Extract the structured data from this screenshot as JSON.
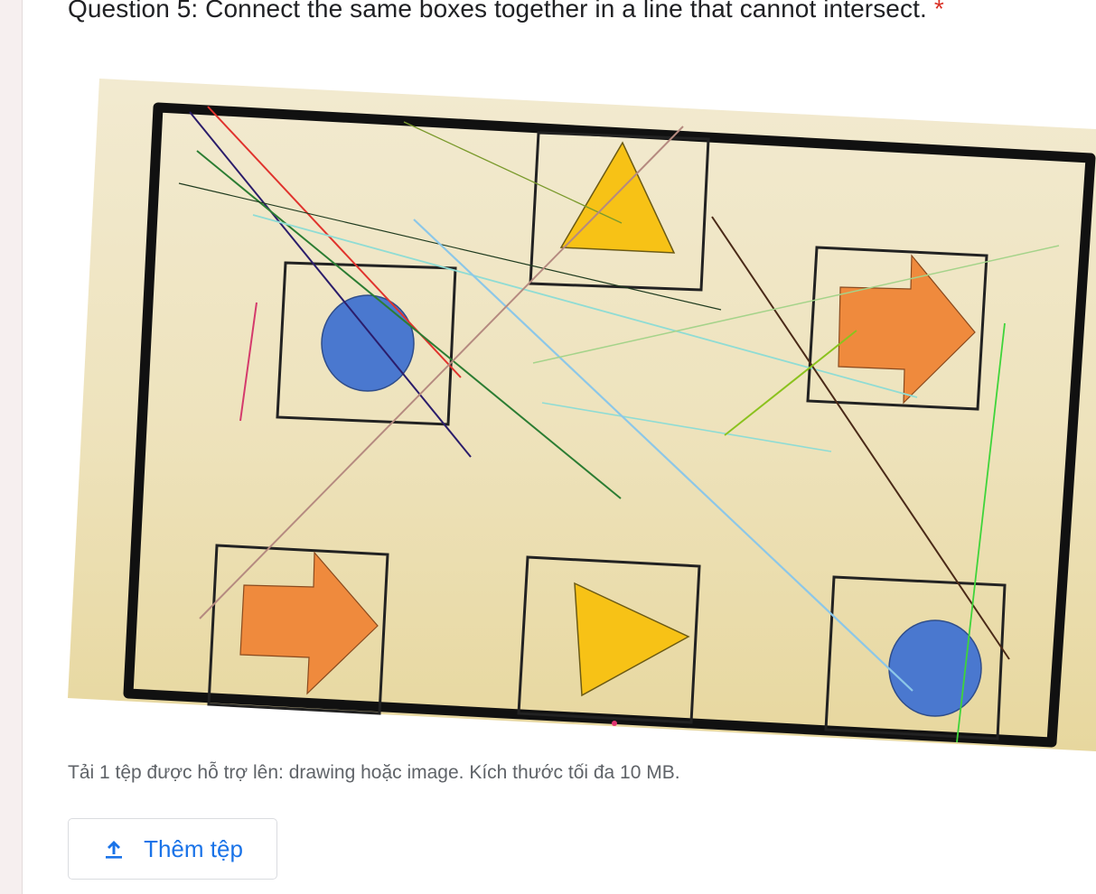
{
  "question": {
    "title": "Question 5:  Connect the same boxes together in a line that cannot intersect.",
    "required_marker": "*"
  },
  "image": {
    "description_shapes": [
      "circle",
      "triangle",
      "arrow",
      "triangle",
      "arrow",
      "circle"
    ]
  },
  "upload": {
    "hint": "Tải 1 tệp được hỗ trợ lên: drawing hoặc image. Kích thước tối đa 10 MB.",
    "button_label": "Thêm tệp",
    "button_icon": "upload-icon"
  },
  "colors": {
    "accent": "#1a73e8",
    "required": "#d93025",
    "paper": "#efe6c2",
    "shape_blue": "#4a78cf",
    "shape_orange": "#ef8a3d",
    "shape_yellow": "#f7c216"
  }
}
